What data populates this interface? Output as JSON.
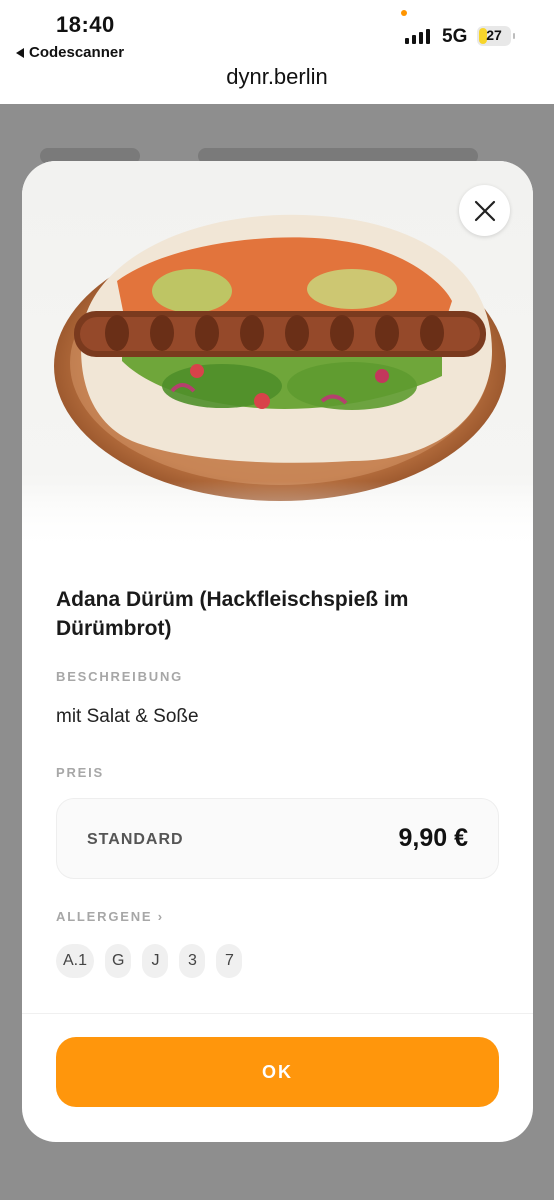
{
  "status_bar": {
    "time": "18:40",
    "back_app": "Codescanner",
    "network": "5G",
    "battery": "27",
    "battery_level": 0.27
  },
  "browser": {
    "url": "dynr.berlin"
  },
  "modal": {
    "title": "Adana Dürüm (Hackfleischspieß im Dürümbrot)",
    "description_label": "BESCHREIBUNG",
    "description": "mit Salat & Soße",
    "price_label": "PREIS",
    "price": {
      "name": "STANDARD",
      "value": "9,90 €"
    },
    "allergens_label": "ALLERGENE ›",
    "allergens": [
      "A.1",
      "G",
      "J",
      "3",
      "7"
    ],
    "ok_label": "OK",
    "close_icon": "close-icon",
    "accent_color": "#ff960c"
  }
}
